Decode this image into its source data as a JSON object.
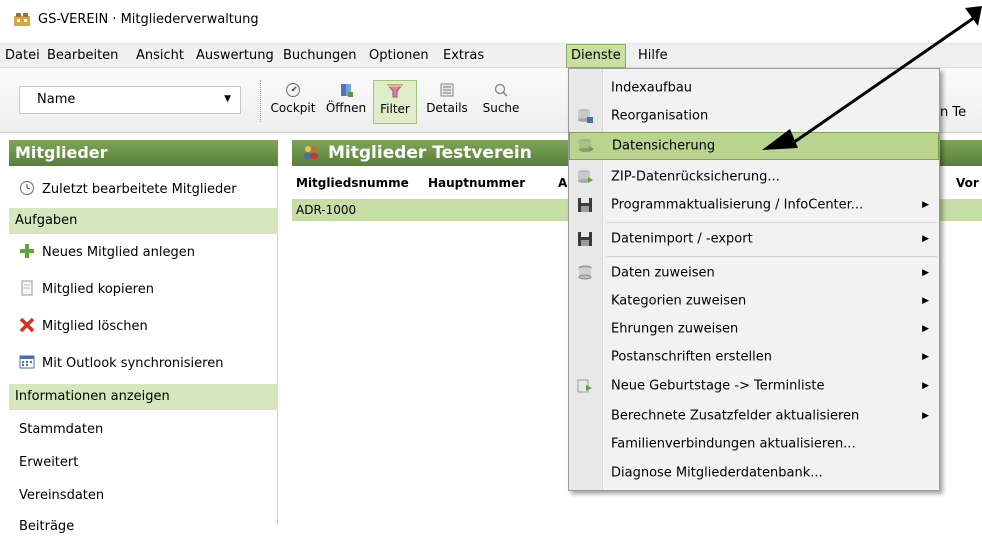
{
  "window": {
    "title": "GS-VEREIN · Mitgliederverwaltung"
  },
  "menubar": {
    "items": [
      "Datei",
      "Bearbeiten",
      "Ansicht",
      "Auswertung",
      "Buchungen",
      "Optionen",
      "Extras",
      "Dienste",
      "Hilfe"
    ],
    "active": "Dienste"
  },
  "toolbar": {
    "combo_value": "Name",
    "buttons": [
      {
        "label": "Cockpit",
        "icon": "gauge-icon"
      },
      {
        "label": "Öffnen",
        "icon": "open-book-icon"
      },
      {
        "label": "Filter",
        "icon": "funnel-icon",
        "pressed": true
      },
      {
        "label": "Details",
        "icon": "details-list-icon"
      },
      {
        "label": "Suche",
        "icon": "magnifier-icon"
      }
    ],
    "partial_right": "n Te"
  },
  "left_panel": {
    "header": "Mitglieder",
    "recent": "Zuletzt bearbeitete Mitglieder",
    "section_tasks": "Aufgaben",
    "tasks": [
      {
        "label": "Neues Mitglied anlegen",
        "icon": "plus-icon"
      },
      {
        "label": "Mitglied kopieren",
        "icon": "copy-document-icon"
      },
      {
        "label": "Mitglied löschen",
        "icon": "delete-x-icon"
      },
      {
        "label": "Mit Outlook synchronisieren",
        "icon": "calendar-icon"
      }
    ],
    "section_info": "Informationen anzeigen",
    "info_items": [
      "Stammdaten",
      "Erweitert",
      "Vereinsdaten",
      "Beiträge"
    ]
  },
  "main": {
    "header": "Mitglieder Testverein",
    "columns": [
      "Mitgliedsnumme",
      "Hauptnummer",
      "A",
      "Vor"
    ],
    "rows": [
      [
        "ADR-1000"
      ]
    ]
  },
  "dropdown": {
    "items": [
      {
        "label": "Indexaufbau",
        "icon": "",
        "submenu": false
      },
      {
        "label": "Reorganisation",
        "icon": "database-tool-icon",
        "submenu": false
      },
      {
        "label": "Datensicherung",
        "icon": "database-backup-icon",
        "submenu": false,
        "highlight": true
      },
      {
        "label": "ZIP-Datenrücksicherung...",
        "icon": "database-restore-icon",
        "submenu": false
      },
      {
        "label": "Programmaktualisierung / InfoCenter...",
        "icon": "floppy-icon",
        "submenu": true
      },
      {
        "label": "Datenimport / -export",
        "icon": "floppy-icon",
        "submenu": true
      },
      {
        "label": "Daten zuweisen",
        "icon": "database-icon",
        "submenu": true
      },
      {
        "label": "Kategorien zuweisen",
        "icon": "",
        "submenu": true
      },
      {
        "label": "Ehrungen zuweisen",
        "icon": "",
        "submenu": true
      },
      {
        "label": "Postanschriften erstellen",
        "icon": "",
        "submenu": true
      },
      {
        "label": "Neue Geburtstage -> Terminliste",
        "icon": "birthday-export-icon",
        "submenu": true
      },
      {
        "label": "Berechnete Zusatzfelder aktualisieren",
        "icon": "",
        "submenu": true
      },
      {
        "label": "Familienverbindungen aktualisieren...",
        "icon": "",
        "submenu": false
      },
      {
        "label": "Diagnose Mitgliederdatenbank...",
        "icon": "",
        "submenu": false
      }
    ]
  },
  "colors": {
    "accent_green_dark": "#587f3a",
    "accent_green_light": "#d6e7bd",
    "highlight_green": "#b9d48e",
    "menu_active": "#c7dfa0"
  }
}
